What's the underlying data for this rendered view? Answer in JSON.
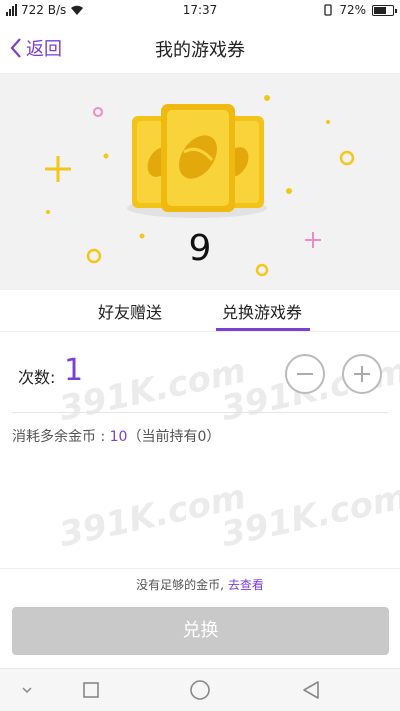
{
  "status_bar": {
    "speed": "722 B/s",
    "time": "17:37",
    "battery": "72%",
    "battery_level": 0.72
  },
  "header": {
    "back_label": "返回",
    "title": "我的游戏券"
  },
  "hero": {
    "ticket_count": "9"
  },
  "tabs": [
    {
      "label": "好友赠送",
      "active": false
    },
    {
      "label": "兑换游戏券",
      "active": true
    }
  ],
  "quantity": {
    "label": "次数:",
    "value": "1"
  },
  "cost": {
    "prefix": "消耗多余金币 : ",
    "amount": "10",
    "suffix": "（当前持有0）"
  },
  "footer": {
    "hint_text": "没有足够的金币,",
    "hint_link": "去查看",
    "exchange_label": "兑换"
  },
  "watermark": "391K.com",
  "colors": {
    "accent": "#7b3fd4",
    "ticket_gold": "#f5c518",
    "disabled_button": "#c9c9c9"
  }
}
